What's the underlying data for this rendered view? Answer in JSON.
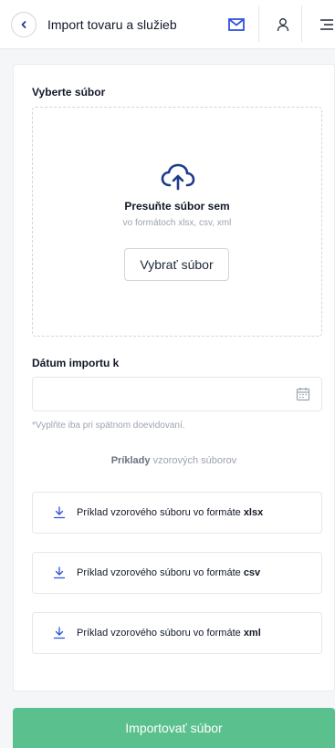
{
  "header": {
    "back_icon": "chevron-left-icon",
    "title": "Import tovaru a služieb",
    "mail_icon": "mail-icon",
    "user_icon": "user-icon",
    "menu_icon": "menu-icon",
    "accent": "#2f52e0"
  },
  "file_section": {
    "label": "Vyberte súbor",
    "dropzone_title": "Presuňte súbor sem",
    "dropzone_subtitle": "vo formátoch xlsx, csv, xml",
    "choose_button": "Vybrať súbor",
    "upload_icon": "cloud-upload-icon",
    "icon_color": "#1e3a8a"
  },
  "date_section": {
    "label": "Dátum importu k",
    "value": "",
    "placeholder": "",
    "hint": "*Vyplňte iba pri spätnom doevidovaní.",
    "calendar_icon": "calendar-icon"
  },
  "examples": {
    "heading_bold": "Príklady",
    "heading_rest": " vzorových súborov",
    "items": [
      {
        "prefix": "Príklad vzorového súboru vo formáte ",
        "format": "xlsx"
      },
      {
        "prefix": "Príklad vzorového súboru vo formáte ",
        "format": "csv"
      },
      {
        "prefix": "Príklad vzorového súboru vo formáte ",
        "format": "xml"
      }
    ],
    "download_icon": "download-icon",
    "download_icon_color": "#2f52e0"
  },
  "import_button": {
    "label": "Importovať súbor",
    "color": "#5ac18e"
  }
}
